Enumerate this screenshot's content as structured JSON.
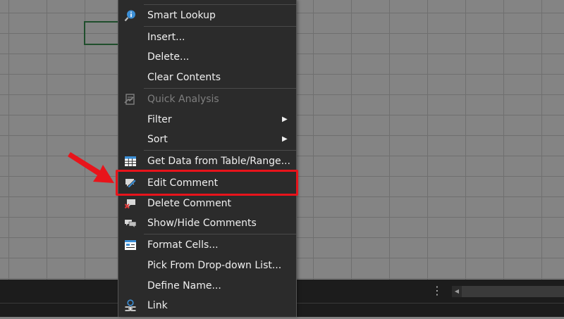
{
  "context_menu": {
    "items": [
      {
        "label": "Smart Lookup",
        "icon": "smart-lookup-icon",
        "disabled": false,
        "submenu": false
      },
      {
        "label": "Insert...",
        "icon": "",
        "disabled": false,
        "submenu": false
      },
      {
        "label": "Delete...",
        "icon": "",
        "disabled": false,
        "submenu": false
      },
      {
        "label": "Clear Contents",
        "icon": "",
        "disabled": false,
        "submenu": false
      },
      {
        "label": "Quick Analysis",
        "icon": "quick-analysis-icon",
        "disabled": true,
        "submenu": false
      },
      {
        "label": "Filter",
        "icon": "",
        "disabled": false,
        "submenu": true
      },
      {
        "label": "Sort",
        "icon": "",
        "disabled": false,
        "submenu": true
      },
      {
        "label": "Get Data from Table/Range...",
        "icon": "table-grid-icon",
        "disabled": false,
        "submenu": false
      },
      {
        "label": "Edit Comment",
        "icon": "edit-comment-icon",
        "disabled": false,
        "submenu": false
      },
      {
        "label": "Delete Comment",
        "icon": "delete-comment-icon",
        "disabled": false,
        "submenu": false
      },
      {
        "label": "Show/Hide Comments",
        "icon": "show-hide-comments-icon",
        "disabled": false,
        "submenu": false
      },
      {
        "label": "Format Cells...",
        "icon": "format-cells-icon",
        "disabled": false,
        "submenu": false
      },
      {
        "label": "Pick From Drop-down List...",
        "icon": "",
        "disabled": false,
        "submenu": false
      },
      {
        "label": "Define Name...",
        "icon": "",
        "disabled": false,
        "submenu": false
      },
      {
        "label": "Link",
        "icon": "link-icon",
        "disabled": false,
        "submenu": false
      }
    ],
    "submenu_glyph": "▶",
    "highlighted_item": "Edit Comment"
  },
  "annotation": {
    "color": "#e8141b"
  },
  "theme": {
    "menu_bg": "#2b2b2b",
    "sheet_bg": "#848484",
    "accent_blue": "#3c8fd6"
  }
}
